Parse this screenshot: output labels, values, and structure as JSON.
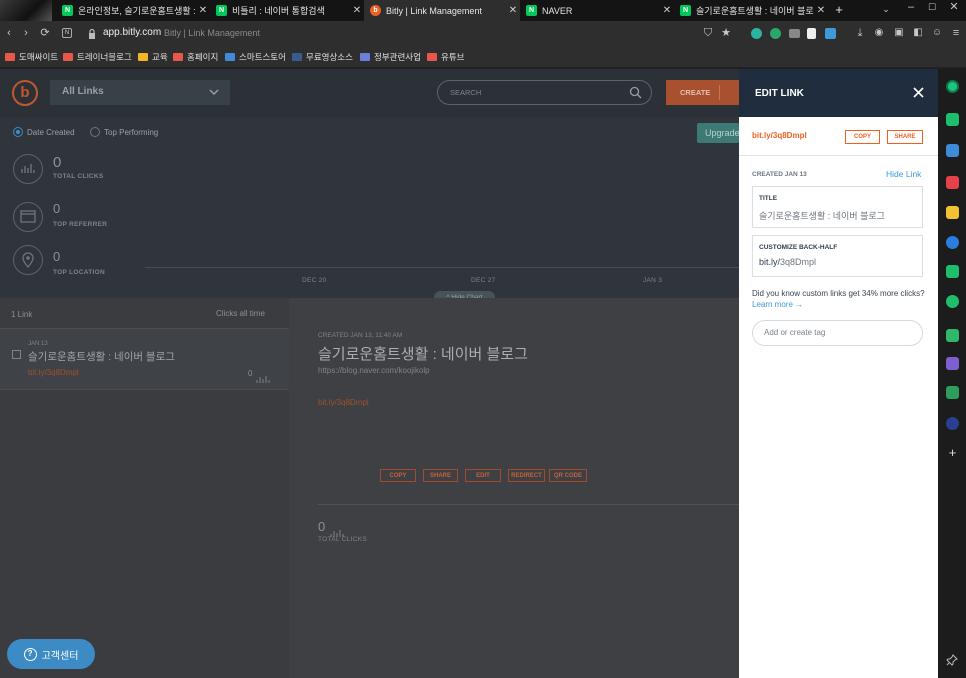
{
  "browser": {
    "tabs": [
      {
        "title": "온라인정보, 슬기로운홈트생활 :",
        "icon_color": "#03c75a"
      },
      {
        "title": "비틀리 : 네이버 통합검색",
        "icon_color": "#03c75a"
      },
      {
        "title": "Bitly | Link Management",
        "icon_color": "#ee6123"
      },
      {
        "title": "NAVER",
        "icon_color": "#03c75a"
      },
      {
        "title": "슬기로운홈트생활 : 네이버 블로",
        "icon_color": "#03c75a"
      }
    ],
    "new_tab": "+",
    "url": "app.bitly.com",
    "page_title_in_bar": "Bitly | Link Management",
    "bookmarks": [
      {
        "label": "도매싸이트",
        "color": "#e8584a"
      },
      {
        "label": "트레이너블로그",
        "color": "#e8584a"
      },
      {
        "label": "교육",
        "color": "#f2b526"
      },
      {
        "label": "홈페이지",
        "color": "#e8584a"
      },
      {
        "label": "스마트스토어",
        "color": "#3d8bd9"
      },
      {
        "label": "무료영상소스",
        "color": "#3b5a8f"
      },
      {
        "label": "정부관련사업",
        "color": "#6a7fd9"
      },
      {
        "label": "유튜브",
        "color": "#e8584a"
      }
    ]
  },
  "app": {
    "logo": "b",
    "links_dropdown": "All Links",
    "search_placeholder": "SEARCH",
    "create_label": "CREATE",
    "upgrade_label": "Upgrade",
    "sort_options": [
      "Date Created",
      "Top Performing"
    ],
    "stats": [
      {
        "value": "0",
        "label": "TOTAL CLICKS"
      },
      {
        "value": "0",
        "label": "TOP REFERRER"
      },
      {
        "value": "0",
        "label": "TOP LOCATION"
      }
    ],
    "chart_dates": [
      "DEC 20",
      "DEC 27",
      "JAN 3"
    ],
    "hide_chart": "^ Hide Chart",
    "list": {
      "count": "1 Link",
      "sort_label": "Clicks all time",
      "items": [
        {
          "date": "JAN 13",
          "title": "슬기로운홈트생활 : 네이버 블로그",
          "short": "bit.ly/3q8Dmpl",
          "clicks": "0"
        }
      ]
    },
    "detail": {
      "created": "CREATED JAN 13, 11:40 AM",
      "title": "슬기로운홈트생활 : 네이버 블로그",
      "url": "https://blog.naver.com/koojikolp",
      "short": "bit.ly/3q8Dmpl",
      "actions": [
        "COPY",
        "SHARE",
        "EDIT",
        "REDIRECT",
        "QR CODE"
      ],
      "clicks": "0",
      "clicks_label": "TOTAL CLICKS"
    }
  },
  "edit_panel": {
    "heading": "EDIT LINK",
    "short": "bit.ly/3q8Dmpl",
    "copy": "COPY",
    "share": "SHARE",
    "created": "CREATED JAN 13",
    "hide_link": "Hide Link",
    "title_label": "TITLE",
    "title_value": "슬기로운홈트생활 : 네이버 블로그",
    "backhalf_label": "CUSTOMIZE BACK-HALF",
    "backhalf_prefix": "bit.ly/",
    "backhalf_value": "3q8Dmpl",
    "tip": "Did you know custom links get 34% more clicks?",
    "learn_more": "Learn more →",
    "tag_placeholder": "Add or create tag"
  },
  "help_button": "고객센터",
  "colors": {
    "brand": "#ee6123",
    "panel_header": "#1f2d3f",
    "link_blue": "#3d9ad6",
    "help_blue": "#3d8bc4"
  }
}
